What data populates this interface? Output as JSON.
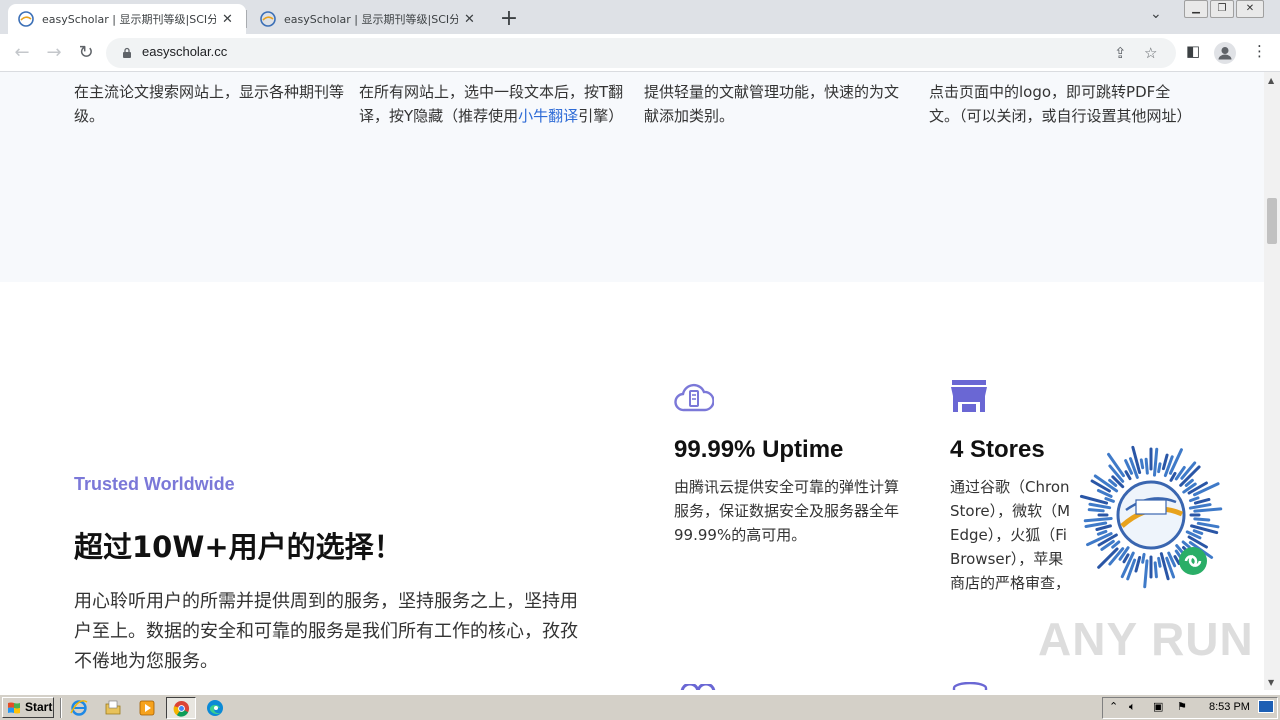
{
  "browser": {
    "tabs": [
      {
        "title": "easyScholar | 显示期刊等级|SCI分区",
        "active": true
      },
      {
        "title": "easyScholar | 显示期刊等级|SCI分区",
        "active": false
      }
    ],
    "url": "easyscholar.cc"
  },
  "features": [
    {
      "text": "在主流论文搜索网站上，显示各种期刊等级。"
    },
    {
      "text_before": "在所有网站上，选中一段文本后，按T翻译，按Y隐藏（推荐使用",
      "link": "小牛翻译",
      "text_after": "引擎）"
    },
    {
      "text": "提供轻量的文献管理功能，快速的为文献添加类别。"
    },
    {
      "text": "点击页面中的logo，即可跳转PDF全文。（可以关闭，或自行设置其他网址）"
    }
  ],
  "trusted": {
    "eyebrow": "Trusted Worldwide",
    "title": "超过10W+用户的选择！",
    "description": "用心聆听用户的所需并提供周到的服务，坚持服务之上，坚持用户至上。数据的安全和可靠的服务是我们所有工作的核心，孜孜不倦地为您服务。"
  },
  "stats": [
    {
      "title": "99.99% Uptime",
      "description": "由腾讯云提供安全可靠的弹性计算服务，保证数据安全及服务器全年99.99%的高可用。",
      "icon": "cloud-server-icon"
    },
    {
      "title": "4 Stores",
      "description_lines": [
        "通过谷歌（Chron",
        "Store），微软（M",
        "Edge），火狐（Fi",
        "Browser），苹果",
        "商店的严格审查，"
      ],
      "icon": "store-icon"
    }
  ],
  "watermark": "ANY RUN",
  "taskbar": {
    "start_label": "Start",
    "clock": "8:53 PM"
  },
  "colors": {
    "accent": "#7b78d8",
    "link": "#2e6bd6",
    "band": "#f7f9fc"
  }
}
